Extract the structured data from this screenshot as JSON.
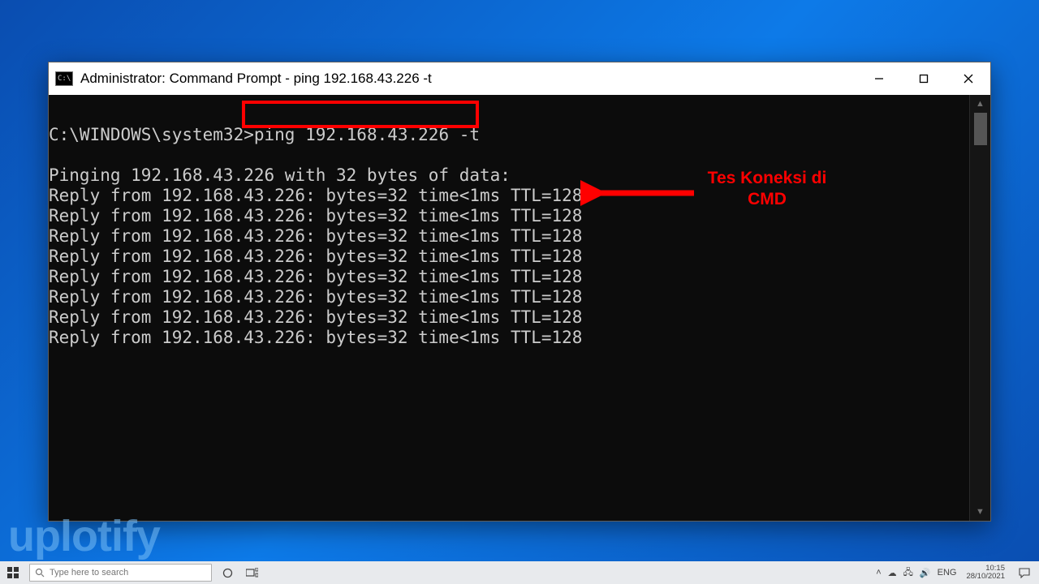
{
  "window": {
    "title": "Administrator: Command Prompt - ping  192.168.43.226 -t",
    "icon_label": "C:\\"
  },
  "terminal": {
    "prompt_prefix": "C:\\WINDOWS\\system32>",
    "command": "ping 192.168.43.226 -t",
    "header": "Pinging 192.168.43.226 with 32 bytes of data:",
    "replies": [
      "Reply from 192.168.43.226: bytes=32 time<1ms TTL=128",
      "Reply from 192.168.43.226: bytes=32 time<1ms TTL=128",
      "Reply from 192.168.43.226: bytes=32 time<1ms TTL=128",
      "Reply from 192.168.43.226: bytes=32 time<1ms TTL=128",
      "Reply from 192.168.43.226: bytes=32 time<1ms TTL=128",
      "Reply from 192.168.43.226: bytes=32 time<1ms TTL=128",
      "Reply from 192.168.43.226: bytes=32 time<1ms TTL=128",
      "Reply from 192.168.43.226: bytes=32 time<1ms TTL=128"
    ]
  },
  "annotation": {
    "line1": "Tes Koneksi di",
    "line2": "CMD",
    "arrow_color": "#ff0000"
  },
  "watermark": "uplotify",
  "taskbar": {
    "search_placeholder": "Type here to search",
    "tray": {
      "lang": "ENG",
      "time": "10:15",
      "date": "28/10/2021"
    }
  }
}
